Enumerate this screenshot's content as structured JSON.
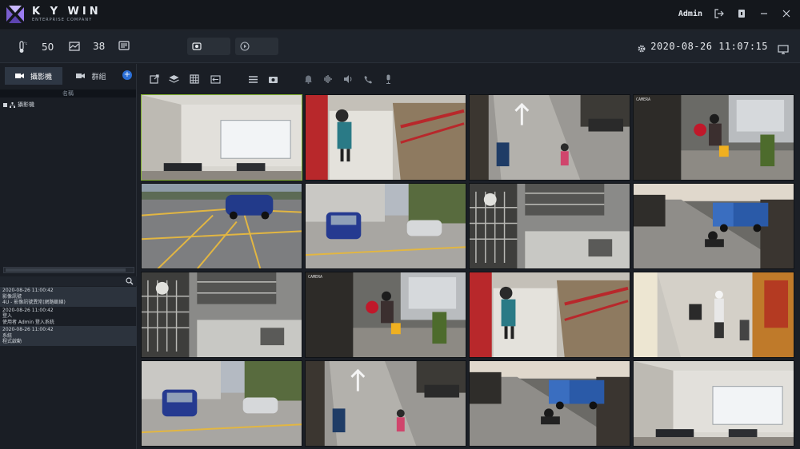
{
  "app": {
    "logo_text": "K Y WIN",
    "logo_sub": "ENTERPRISE COMPANY",
    "user": "Admin"
  },
  "toolbar": {
    "temperature": "50",
    "bandwidth": "38",
    "datetime": "2020-08-26 11:07:15"
  },
  "left_panel": {
    "tabs": [
      {
        "label": "攝影機",
        "icon": "camera-icon"
      },
      {
        "label": "群組",
        "icon": "camera-group-icon"
      }
    ],
    "column_header": "名稱",
    "tree_root": "攝影機",
    "logs": [
      {
        "time": "2020-08-26 11:00:42",
        "lines": [
          "影像訊號",
          "4U - 影像訊號異常(網路斷線)"
        ]
      },
      {
        "time": "2020-08-26 11:00:42",
        "lines": [
          "登入",
          "使用者 Admin 登入系統"
        ]
      },
      {
        "time": "2020-08-26 11:00:42",
        "lines": [
          "系統",
          "程式啟動"
        ]
      }
    ]
  },
  "video_toolbar": {
    "icons": [
      "popout-icon",
      "layers-icon",
      "grid-layout-icon",
      "sequence-icon",
      "list-icon",
      "snapshot-icon",
      "alarm-icon",
      "audio-wave-icon",
      "speaker-icon",
      "phone-icon",
      "mic-icon"
    ]
  },
  "cameras": [
    {
      "label": "",
      "scene": "room-white"
    },
    {
      "label": "",
      "scene": "stairs-red"
    },
    {
      "label": "",
      "scene": "street-arrow"
    },
    {
      "label": "CAMERA",
      "scene": "doorway"
    },
    {
      "label": "",
      "scene": "parking-yellow"
    },
    {
      "label": "",
      "scene": "lot-blue-car"
    },
    {
      "label": "",
      "scene": "warehouse"
    },
    {
      "label": "",
      "scene": "alley-truck"
    },
    {
      "label": "",
      "scene": "warehouse"
    },
    {
      "label": "CAMERA",
      "scene": "doorway"
    },
    {
      "label": "",
      "scene": "stairs-red"
    },
    {
      "label": "",
      "scene": "alley-walk"
    },
    {
      "label": "",
      "scene": "lot-blue-car"
    },
    {
      "label": "",
      "scene": "street-arrow"
    },
    {
      "label": "",
      "scene": "alley-truck"
    },
    {
      "label": "",
      "scene": "room-white"
    }
  ]
}
